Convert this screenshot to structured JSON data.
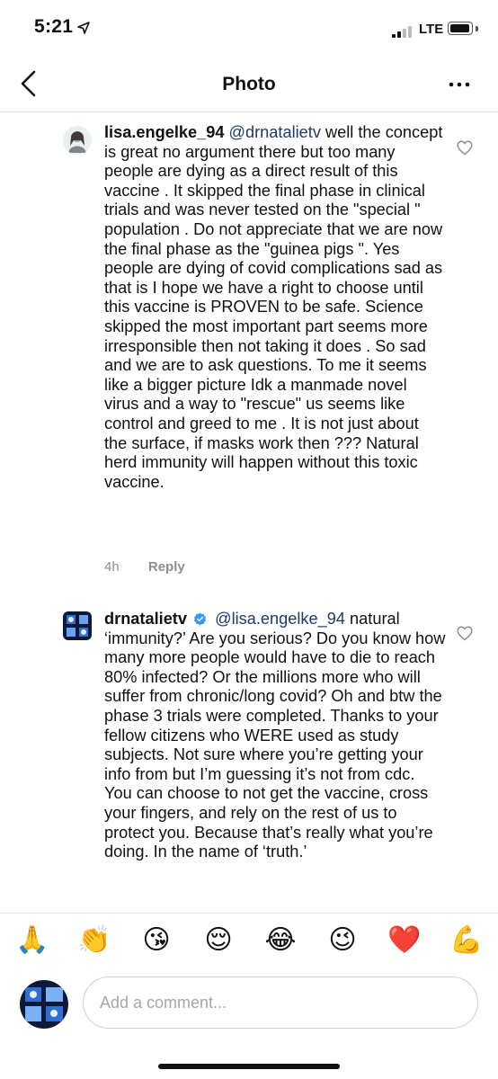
{
  "status_bar": {
    "time": "5:21",
    "network": "LTE",
    "icons": {
      "location": "location-arrow-icon",
      "signal": "cellular-signal-icon",
      "battery": "battery-icon"
    }
  },
  "nav": {
    "title": "Photo",
    "back_icon": "back-chevron-icon",
    "more_icon": "more-horizontal-icon"
  },
  "comments": [
    {
      "username": "lisa.engelke_94",
      "mention": "@drnatalietv",
      "text": "well the concept  is great no argument  there but too many  people  are dying as a direct result  of this vaccine . It skipped the final phase in clinical  trials  and was never tested on the \"special \" population . Do not appreciate  that we are now the final phase as the \"guinea pigs \". Yes people  are dying of covid complications  sad as that is I hope we have a right to choose until this vaccine is PROVEN  to be safe. Science skipped the most important  part seems more irresponsible  then not taking it does . So sad and we are to ask questions. To me it seems like a bigger picture Idk a manmade novel virus and  a way to \"rescue\" us seems like control and greed to me . It is  not just about the surface, if masks work then ??? Natural herd immunity  will happen without  this toxic vaccine.",
      "time": "4h",
      "reply_label": "Reply",
      "verified": false
    },
    {
      "username": "drnatalietv",
      "mention": "@lisa.engelke_94",
      "text": "natural ‘immunity?’ Are you serious? Do you know how many more people would have to die to reach 80% infected? Or the millions more who will suffer from chronic/long covid? Oh and btw the phase 3 trials were completed. Thanks to your fellow citizens who WERE used as study subjects. Not sure where you’re getting your info from but I’m guessing it’s not from cdc.  You can choose to not get the vaccine, cross your fingers, and rely on the rest of us to protect you. Because that’s really what you’re doing. In the name of ‘truth.’",
      "verified": true
    }
  ],
  "emoji_bar": [
    {
      "name": "folded-hands",
      "glyph": "🙏"
    },
    {
      "name": "clapping-hands",
      "glyph": "👏"
    },
    {
      "name": "face-blowing-kiss",
      "glyph": "😘"
    },
    {
      "name": "relieved-face",
      "glyph": "😌"
    },
    {
      "name": "face-with-tears-of-joy",
      "glyph": "😂"
    },
    {
      "name": "winking-face",
      "glyph": "😉"
    },
    {
      "name": "red-heart",
      "glyph": "❤️"
    },
    {
      "name": "flexed-biceps",
      "glyph": "💪"
    }
  ],
  "composer": {
    "placeholder": "Add a comment..."
  },
  "colors": {
    "mention": "#1f3a6b",
    "meta_gray": "#8e8e8e",
    "verified_blue": "#3897f0"
  }
}
